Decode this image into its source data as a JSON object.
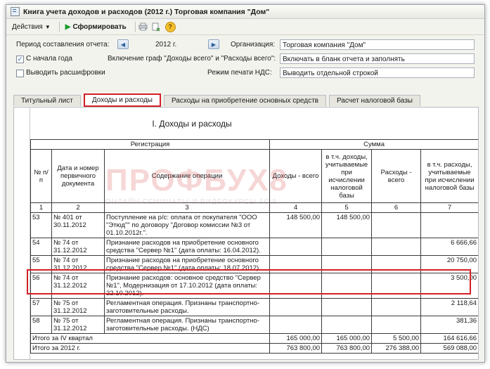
{
  "window": {
    "title": "Книга учета доходов и расходов (2012 г.) Торговая компания \"Дом\""
  },
  "toolbar": {
    "actions_label": "Действия",
    "generate_label": "Сформировать",
    "help_label": "?"
  },
  "form": {
    "period_label": "Период составления отчета:",
    "period_value": "2012 г.",
    "org_label": "Организация:",
    "org_value": "Торговая компания \"Дом\"",
    "from_start_label": "С начала года",
    "from_start_checked": "✓",
    "include_label": "Включение граф \"Доходы всего\" и \"Расходы всего\":",
    "include_value": "Включать в бланк отчета и заполнять",
    "decode_label": "Выводить расшифровки",
    "vat_label": "Режим печати НДС:",
    "vat_value": "Выводить отдельной строкой"
  },
  "tabs": [
    {
      "label": "Титульный лист"
    },
    {
      "label": "Доходы и расходы"
    },
    {
      "label": "Расходы на приобретение основных средств"
    },
    {
      "label": "Расчет налоговой базы"
    }
  ],
  "watermark": {
    "big": "ПРОФБУХ8",
    "small": "ОНЛАЙН СЕМИНАРЫ И ВИДЕОКУРСЫ 1С:8"
  },
  "report": {
    "section_title": "I. Доходы и расходы",
    "header": {
      "registration": "Регистрация",
      "sum": "Сумма",
      "num": "№ п/п",
      "doc": "Дата и номер первичного документа",
      "content": "Содержание операции",
      "income_total": "Доходы - всего",
      "income_taxable": "в т.ч. доходы, учитываемые при исчислении налоговой базы",
      "expense_total": "Расходы - всего",
      "expense_taxable": "в т.ч. расходы, учитываемые при исчислении налоговой базы",
      "col_nums": [
        "1",
        "2",
        "3",
        "4",
        "5",
        "6",
        "7"
      ]
    },
    "rows": [
      {
        "n": "53",
        "doc": "№ 401 от 30.11.2012",
        "content": "Поступление на р/с: оплата от покупателя \"ООО \"Этюд\"\" по договору \"Договор комиссии №3 от 01.10.2012г.\".",
        "c4": "148 500,00",
        "c5": "148 500,00",
        "c6": "",
        "c7": ""
      },
      {
        "n": "54",
        "doc": "№ 74 от 31.12.2012",
        "content": "Признание расходов на приобретение основного средства \"Сервер №1\" (дата оплаты: 16.04.2012).",
        "c4": "",
        "c5": "",
        "c6": "",
        "c7": "6 666,66"
      },
      {
        "n": "55",
        "doc": "№ 74 от 31.12.2012",
        "content": "Признание расходов на приобретение основного средства \"Сервер №1\" (дата оплаты: 18.07.2012).",
        "c4": "",
        "c5": "",
        "c6": "",
        "c7": "20 750,00"
      },
      {
        "n": "56",
        "doc": "№ 74 от 31.12.2012",
        "content": "Признание расходов: основное средство \"Сервер №1\", Модернизация от 17.10.2012 (дата оплаты: 22.10.2012).",
        "c4": "",
        "c5": "",
        "c6": "",
        "c7": "3 500,00"
      },
      {
        "n": "57",
        "doc": "№ 75 от 31.12.2012",
        "content": "Регламентная операция. Признаны транспортно-заготовительные расходы.",
        "c4": "",
        "c5": "",
        "c6": "",
        "c7": "2 118,64"
      },
      {
        "n": "58",
        "doc": "№ 75 от 31.12.2012",
        "content": "Регламентная операция. Признаны транспортно-заготовительные расходы. (НДС)",
        "c4": "",
        "c5": "",
        "c6": "",
        "c7": "381,36"
      }
    ],
    "totals": [
      {
        "label": "Итого за IV квартал",
        "c4": "165 000,00",
        "c5": "165 000,00",
        "c6": "5 500,00",
        "c7": "164 616,66"
      },
      {
        "label": "Итого за 2012 г.",
        "c4": "763 800,00",
        "c5": "763 800,00",
        "c6": "276 388,00",
        "c7": "569 088,00"
      }
    ]
  }
}
